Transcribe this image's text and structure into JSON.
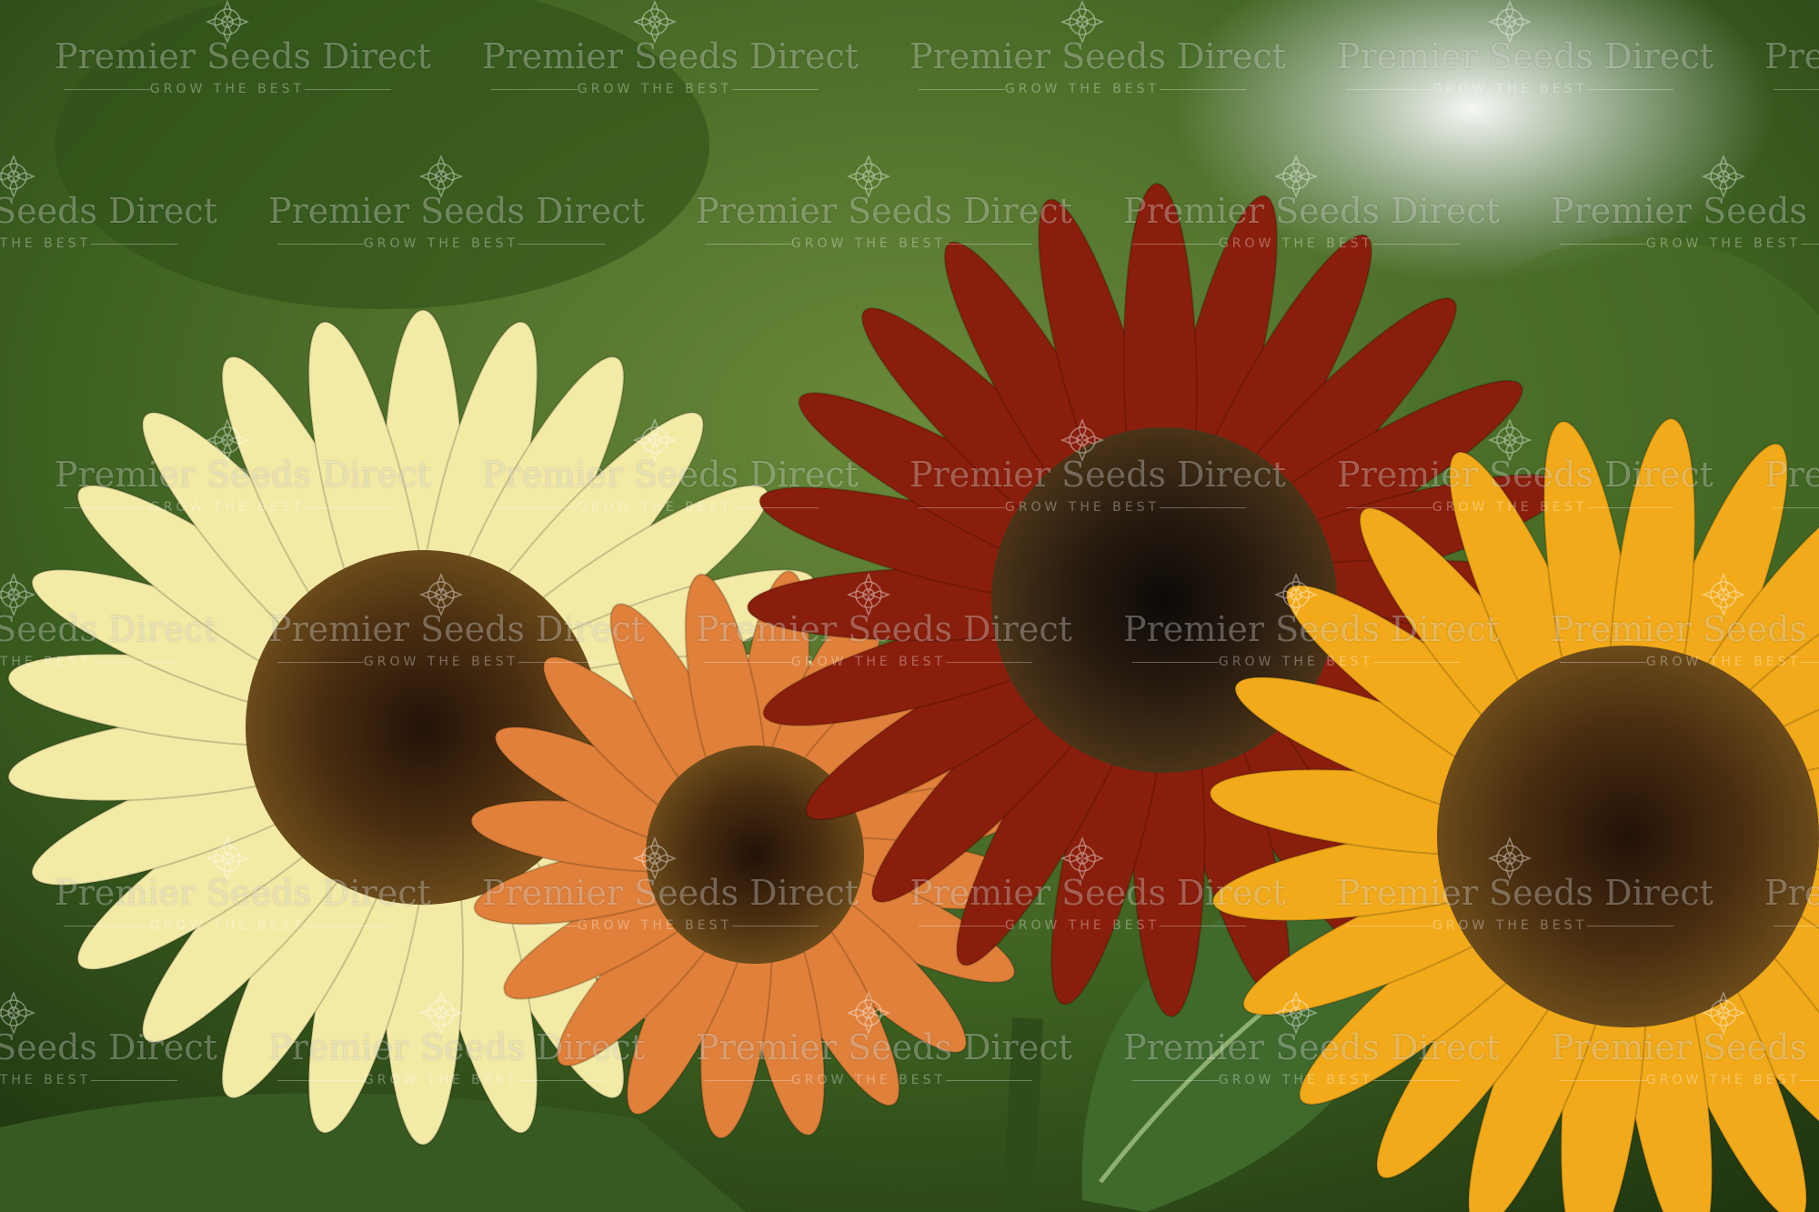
{
  "watermark": {
    "brand": "Premier Seeds Direct",
    "tagline": "GROW THE BEST",
    "emblem": "mandala-logo"
  },
  "scene": {
    "subject": "sunflowers",
    "flowers": [
      {
        "name": "pale-yellow-sunflower",
        "petal_color": "#f3eaa6",
        "center_color": "#4a2e10"
      },
      {
        "name": "orange-bicolor-sunflower",
        "petal_color": "#e0803a",
        "center_color": "#3a2410"
      },
      {
        "name": "red-sunflower",
        "petal_color": "#8a1e0c",
        "center_color": "#2a1c10"
      },
      {
        "name": "golden-yellow-sunflower",
        "petal_color": "#f2aa1a",
        "center_color": "#3a2208"
      }
    ],
    "colors": {
      "background": "#3c6020",
      "leaf": "#3f6a2c"
    }
  }
}
